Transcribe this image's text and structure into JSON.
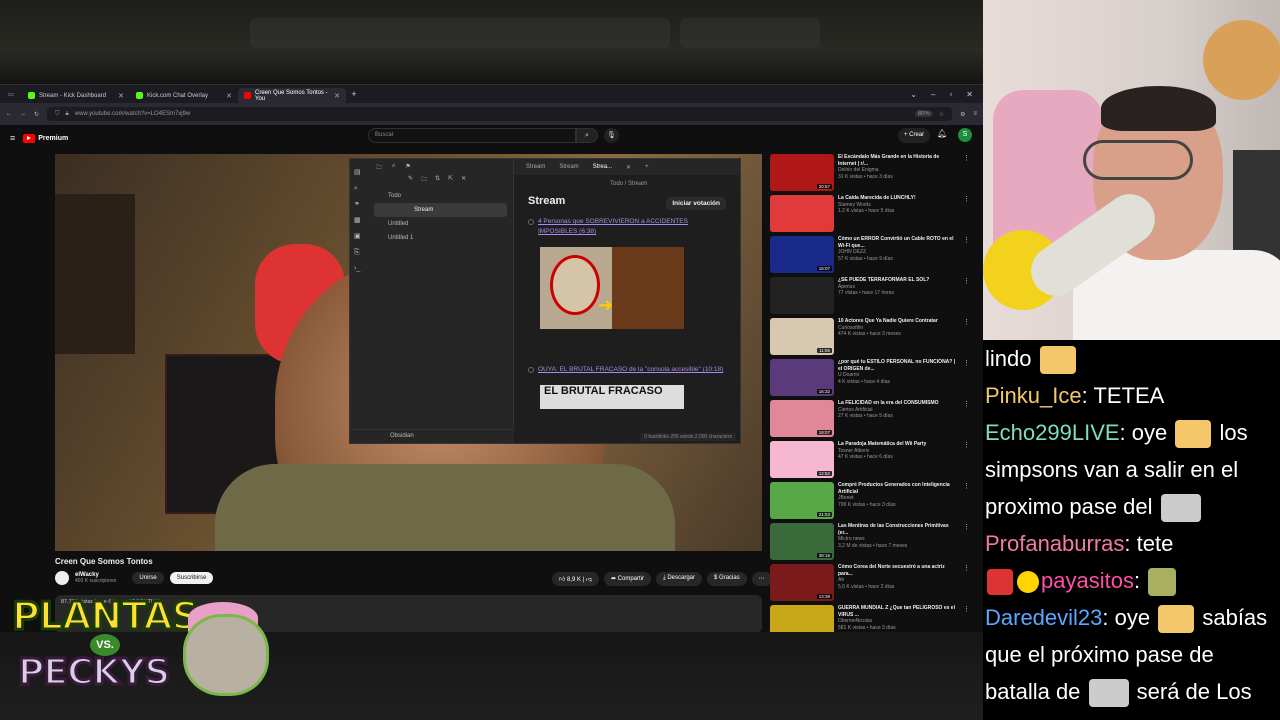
{
  "browser": {
    "tabs": [
      {
        "label": "Stream - Kick Dashboard",
        "active": false
      },
      {
        "label": "Kick.com Chat Overlay",
        "active": false
      },
      {
        "label": "Creen Que Somos Tontos - You",
        "active": true
      }
    ],
    "url": "www.youtube.com/watch?v=LO4ESm7xj9w",
    "zoom": "80%"
  },
  "youtube": {
    "logo": "Premium",
    "search_placeholder": "Buscar",
    "create_label": "+ Crear",
    "avatar_letter": "S",
    "video_title": "Creen Que Somos Tontos",
    "channel": "elWacky",
    "subscribers": "403 K suscriptores",
    "join": "Unirse",
    "subscribe": "Suscribirse",
    "likes": "8,9 K",
    "share": "Compartir",
    "download": "Descargar",
    "thanks": "Gracias",
    "description": "87,756 vistas  hace 6 horas  ARGENTINA"
  },
  "obsidian": {
    "tabs": [
      "Stream",
      "Stream",
      "Strea..."
    ],
    "files": [
      "Todo",
      "Stream",
      "Untitled",
      "Untitled 1"
    ],
    "vault": "Obsidian",
    "breadcrumb": "Todo / Stream",
    "heading": "Stream",
    "vote_button": "Iniciar votación",
    "link1": "4 Personas que SOBREVIVIERON a ACCIDENTES IMPOSIBLES (6:38)",
    "link2": "OUYA: EL BRUTAL FRACASO de la \"consola accesible\" (10:18)",
    "thumb2_text": "EL BRUTAL FRACASO",
    "status": "0 backlinks   255 words   2,000 characters"
  },
  "sidebar": [
    {
      "title": "El Escándalo Más Grande en la Historia de Internet | r/...",
      "channel": "Delirio del Enigma",
      "meta": "31 K vistas • hace 3 días",
      "dur": "20:57",
      "color": "#b01818"
    },
    {
      "title": "La Caída Marecida de LUNCHLY!",
      "channel": "Stamey Words",
      "meta": "1,2 K vistas • hace 5 días",
      "dur": "",
      "color": "#e23a3a"
    },
    {
      "title": "Cómo un ERROR Convirtió un Cable ROTO en el Wi-Fi que...",
      "channel": "JOHN DEZZ",
      "meta": "57 K vistas • hace 9 días",
      "dur": "16:07",
      "color": "#1a2a8a"
    },
    {
      "title": "¿SE PUEDE TERRAFORMAR EL SOL?",
      "channel": "Aperiux",
      "meta": "77 vistas • hace 17 horas",
      "dur": "",
      "color": "#222"
    },
    {
      "title": "10 Actores Que Ya Nadie Quiere Contratar",
      "channel": "Curiosofilm",
      "meta": "474 K vistas • hace 3 meses",
      "dur": "11:55",
      "color": "#d8c8b0"
    },
    {
      "title": "¿por qué tu ESTILO PERSONAL no FUNCIONA? | el ORIGEN de...",
      "channel": "U Doarmi",
      "meta": "4 K vistas • hace 4 días",
      "dur": "16:32",
      "color": "#5a3a7a"
    },
    {
      "title": "La FELICIDAD en la era del CONSUMISMO",
      "channel": "Ciertos Artificial",
      "meta": "27 K vistas • hace 5 días",
      "dur": "18:07",
      "color": "#e08898"
    },
    {
      "title": "La Paradoja Matemática del Wii Party",
      "channel": "Tosner Alborix",
      "meta": "47 K vistas • hace 6 días",
      "dur": "12:52",
      "color": "#f5b8d0"
    },
    {
      "title": "Compré Productos Generados con Inteligencia Artificial",
      "channel": "JBenet",
      "meta": "799 K vistas • hace 3 días",
      "dur": "21:53",
      "color": "#58a848"
    },
    {
      "title": "Las Mentiras de las Construcciones Primitivas (er...",
      "channel": "Mictro news",
      "meta": "3,2 M de vistas • hace 7 meses",
      "dur": "38:16",
      "color": "#3a6a3a"
    },
    {
      "title": "Cómo Corea del Norte secuestró a una actriz para...",
      "channel": "Ab",
      "meta": "5,6 K vistas • hace 2 días",
      "dur": "13:39",
      "color": "#7a1a1a"
    },
    {
      "title": "GUERRA MUNDIAL Z ¿Que tan PELIGROSO es el VIRUS ...",
      "channel": "ObsrmeNicolas",
      "meta": "581 K vistas • hace 3 días",
      "dur": "",
      "color": "#c8a818"
    }
  ],
  "chat": [
    {
      "user": "",
      "text": "lindo",
      "color": "#ffffff"
    },
    {
      "user": "Pinku_Ice",
      "text": "TETEA",
      "color": "#f4c86a"
    },
    {
      "user": "Echo299LIVE",
      "text": "oye  los simpsons van a salir en el proximo pase del",
      "color": "#7ee0b8"
    },
    {
      "user": "Profanaburras",
      "text": "tete",
      "color": "#f07aa8"
    },
    {
      "user": "payasitos",
      "text": "",
      "color": "#ff4fa8"
    },
    {
      "user": "Daredevil23",
      "text": "oye  sabías que el próximo pase de batalla de  será de Los Simpsons?",
      "color": "#5aa8ff"
    }
  ],
  "logo": {
    "line1": "PLANTAS",
    "vs": "VS.",
    "line2": "PECKYS"
  }
}
